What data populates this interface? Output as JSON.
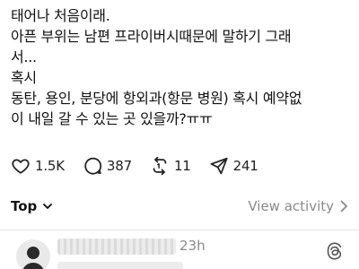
{
  "post": {
    "lines": [
      "태어나 처음이래.",
      "아픈 부위는 남편 프라이버시때문에 말하기 그래",
      "서...",
      "혹시",
      "동탄, 용인, 분당에 항외과(항문 병원) 혹시 예약없",
      "이 내일 갈 수 있는 곳 있을까?ㅠㅠ"
    ]
  },
  "actions": {
    "likes": "1.5K",
    "comments": "387",
    "reposts": "11",
    "shares": "241"
  },
  "sort": {
    "label": "Top",
    "view_activity": "View activity"
  },
  "reply": {
    "time": "23h"
  },
  "icons": [
    "heart-icon",
    "comment-icon",
    "repost-icon",
    "share-icon",
    "chevron-down-icon",
    "chevron-right-icon",
    "threads-logo-icon"
  ]
}
